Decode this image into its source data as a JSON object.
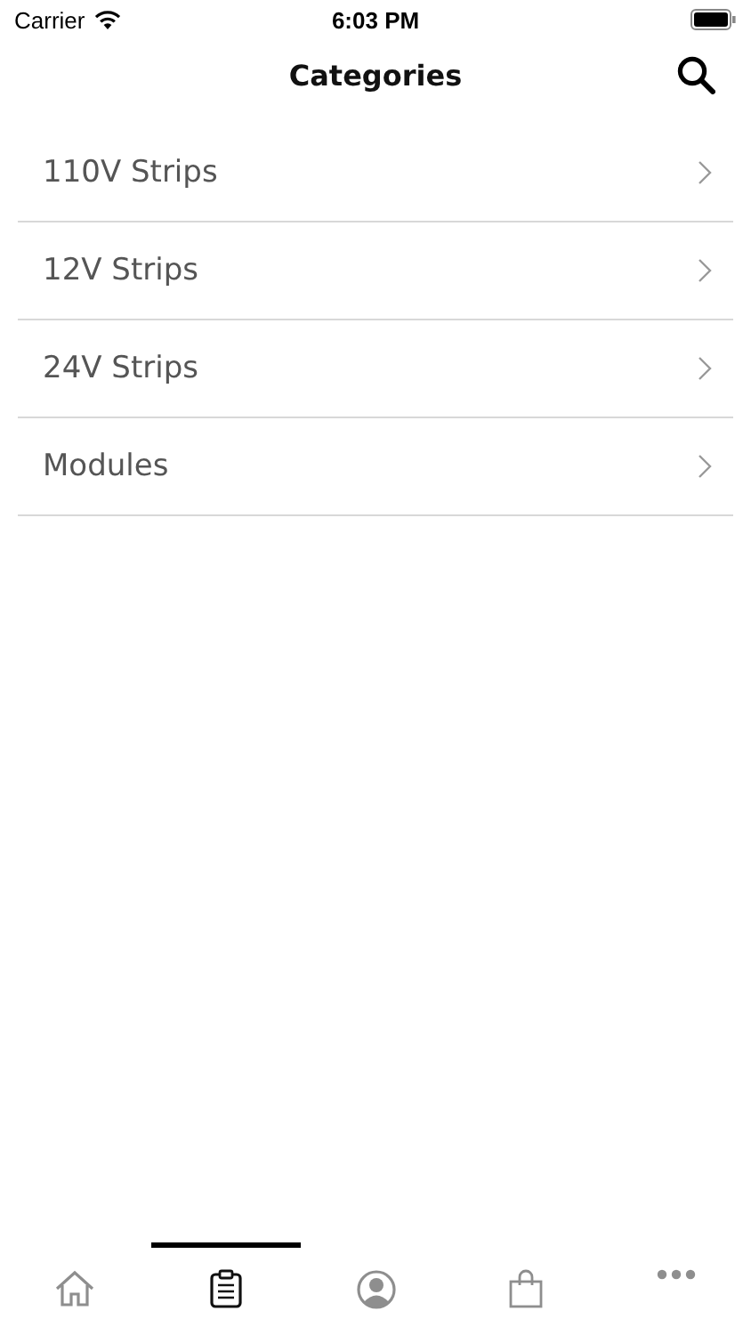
{
  "status_bar": {
    "carrier": "Carrier",
    "time": "6:03 PM"
  },
  "header": {
    "title": "Categories"
  },
  "categories": [
    {
      "label": "110V Strips"
    },
    {
      "label": "12V Strips"
    },
    {
      "label": "24V Strips"
    },
    {
      "label": "Modules"
    }
  ],
  "tabs": [
    {
      "kind": "home",
      "selected": false
    },
    {
      "kind": "clipboard",
      "selected": true
    },
    {
      "kind": "profile",
      "selected": false
    },
    {
      "kind": "bag",
      "selected": false
    },
    {
      "kind": "more",
      "selected": false
    }
  ]
}
